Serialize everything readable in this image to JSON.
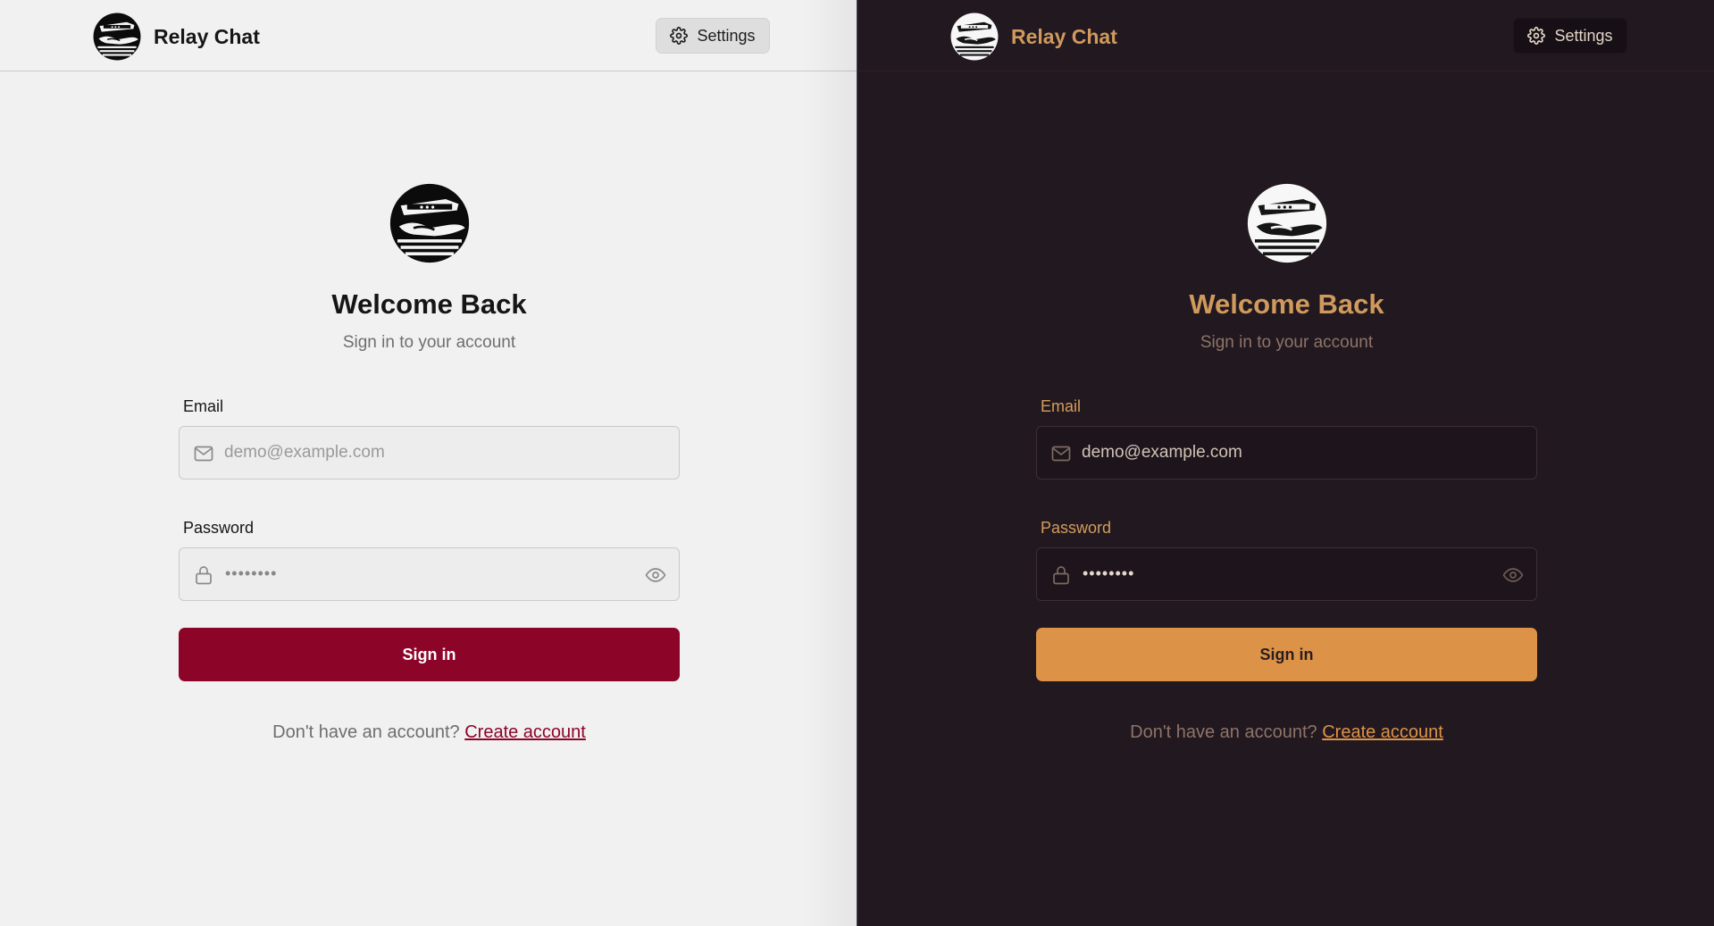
{
  "app": {
    "name": "Relay Chat"
  },
  "header": {
    "settings_label": "Settings"
  },
  "login": {
    "title": "Welcome Back",
    "subtitle": "Sign in to your account",
    "email_label": "Email",
    "email_placeholder": "demo@example.com",
    "password_label": "Password",
    "password_mask": "••••••••",
    "submit_label": "Sign in",
    "footer_prompt": "Don't have an account?",
    "footer_link": "Create account"
  },
  "themes": {
    "light": {
      "accent": "#8d0429",
      "background": "#f1f1f1"
    },
    "dark": {
      "accent": "#dc9348",
      "background": "#221820"
    }
  },
  "icons": [
    "relay-logo-icon",
    "gear-icon",
    "mail-icon",
    "lock-icon",
    "eye-icon"
  ]
}
